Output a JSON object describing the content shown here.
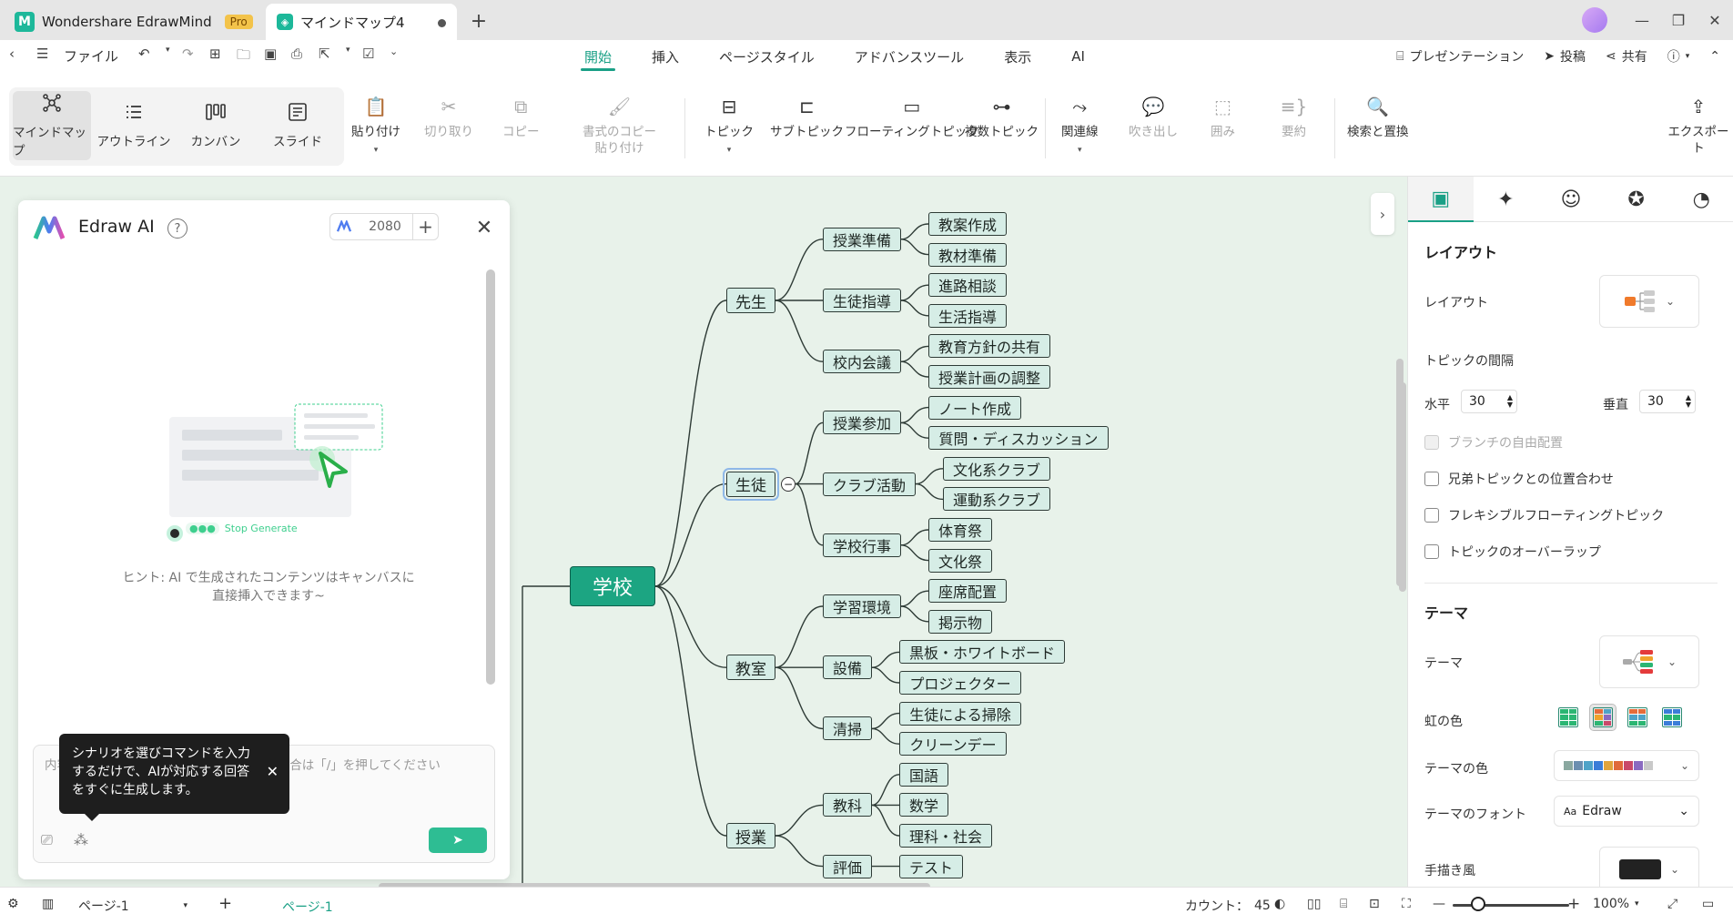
{
  "app": {
    "name": "Wondershare EdrawMind",
    "badge": "Pro",
    "doc_title": "マインドマップ4"
  },
  "menu": {
    "file": "ファイル",
    "tabs": [
      "開始",
      "挿入",
      "ページスタイル",
      "アドバンスツール",
      "表示",
      "AI"
    ],
    "active_tab": "開始",
    "right": {
      "presentation": "プレゼンテーション",
      "post": "投稿",
      "share": "共有"
    }
  },
  "ribbon": {
    "views": [
      {
        "label": "マインドマップ",
        "icon": "mindmap-icon",
        "active": true
      },
      {
        "label": "アウトライン",
        "icon": "outline-icon",
        "active": false
      },
      {
        "label": "カンバン",
        "icon": "kanban-icon",
        "active": false
      },
      {
        "label": "スライド",
        "icon": "slide-icon",
        "active": false
      }
    ],
    "paste": "貼り付け",
    "cut": "切り取り",
    "copy": "コピー",
    "format_copy_1": "書式のコピー",
    "format_copy_2": "貼り付け",
    "topic": "トピック",
    "subtopic": "サブトピック",
    "floating": "フローティングトピック",
    "multi": "複数トピック",
    "relation": "関連線",
    "callout": "吹き出し",
    "boundary": "囲み",
    "summary": "要約",
    "find": "検索と置換",
    "export": "エクスポート"
  },
  "ai_panel": {
    "title": "Edraw AI",
    "credits": "2080",
    "stop_generate": "Stop Generate",
    "hint_line1": "ヒント: AI で生成されたコンテンツはキャンバスに",
    "hint_line2": "直接挿入できます~",
    "input_placeholder": "内容を入力してください。シナリオを選ぶ場合は「/」を押してください",
    "tooltip": "シナリオを選びコマンドを入力するだけで、AIが対応する回答をすぐに生成します。"
  },
  "mindmap": {
    "root": "学校",
    "branches": [
      {
        "label": "先生",
        "children": [
          {
            "label": "授業準備",
            "children": [
              "教案作成",
              "教材準備"
            ]
          },
          {
            "label": "生徒指導",
            "children": [
              "進路相談",
              "生活指導"
            ]
          },
          {
            "label": "校内会議",
            "children": [
              "教育方針の共有",
              "授業計画の調整"
            ]
          }
        ]
      },
      {
        "label": "生徒",
        "children": [
          {
            "label": "授業参加",
            "children": [
              "ノート作成",
              "質問・ディスカッション"
            ]
          },
          {
            "label": "クラブ活動",
            "children": [
              "文化系クラブ",
              "運動系クラブ"
            ]
          },
          {
            "label": "学校行事",
            "children": [
              "体育祭",
              "文化祭"
            ]
          }
        ]
      },
      {
        "label": "教室",
        "children": [
          {
            "label": "学習環境",
            "children": [
              "座席配置",
              "掲示物"
            ]
          },
          {
            "label": "設備",
            "children": [
              "黒板・ホワイトボード",
              "プロジェクター"
            ]
          },
          {
            "label": "清掃",
            "children": [
              "生徒による掃除",
              "クリーンデー"
            ]
          }
        ]
      },
      {
        "label": "授業",
        "children": [
          {
            "label": "教科",
            "children": [
              "国語",
              "数学",
              "理科・社会"
            ]
          },
          {
            "label": "評価",
            "children": [
              "テスト"
            ]
          }
        ]
      }
    ]
  },
  "right_panel": {
    "layout_section": "レイアウト",
    "layout_label": "レイアウト",
    "spacing_label": "トピックの間隔",
    "horizontal_label": "水平",
    "horizontal_value": "30",
    "vertical_label": "垂直",
    "vertical_value": "30",
    "options": [
      {
        "label": "ブランチの自由配置",
        "disabled": true
      },
      {
        "label": "兄弟トピックとの位置合わせ",
        "disabled": false
      },
      {
        "label": "フレキシブルフローティングトピック",
        "disabled": false
      },
      {
        "label": "トピックのオーバーラップ",
        "disabled": false
      }
    ],
    "theme_section": "テーマ",
    "theme_label": "テーマ",
    "rainbow_label": "虹の色",
    "theme_color_label": "テーマの色",
    "theme_font_label": "テーマのフォント",
    "theme_font_value": "Edraw",
    "handdrawn_label": "手描き風",
    "theme_colors": [
      "#8aa8a0",
      "#6c8fb0",
      "#4fa3c8",
      "#3b7dd8",
      "#e0a43c",
      "#e06a3a",
      "#c9496a",
      "#8a6ac0",
      "#c9c9c9"
    ]
  },
  "status": {
    "page_select": "ページ-1",
    "page_tab": "ページ-1",
    "count_label": "カウント：",
    "count_value": "45",
    "zoom": "100%"
  },
  "colors": {
    "accent": "#1aa086",
    "canvas": "#e8f2ea",
    "root": "#1ca582"
  }
}
